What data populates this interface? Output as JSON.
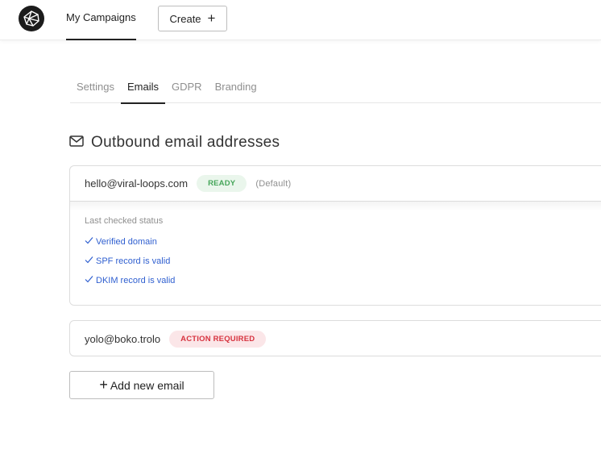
{
  "topbar": {
    "logo_icon": "viral-loops-logo-icon",
    "nav_item": "My Campaigns",
    "create_label": "Create",
    "create_icon": "plus-icon"
  },
  "tabs": [
    {
      "label": "Settings",
      "active": false
    },
    {
      "label": "Emails",
      "active": true
    },
    {
      "label": "GDPR",
      "active": false
    },
    {
      "label": "Branding",
      "active": false
    }
  ],
  "section": {
    "icon": "envelope-icon",
    "title": "Outbound email addresses"
  },
  "emails": [
    {
      "address": "hello@viral-loops.com",
      "status": "READY",
      "status_color": "#46a65a",
      "note": "(Default)",
      "expanded": true,
      "last_checked_label": "Last checked status",
      "checks": [
        {
          "icon": "checkmark-icon",
          "label": "Verified domain"
        },
        {
          "icon": "checkmark-icon",
          "label": "SPF record is valid"
        },
        {
          "icon": "checkmark-icon",
          "label": "DKIM record is valid"
        }
      ]
    },
    {
      "address": "yolo@boko.trolo",
      "status": "ACTION REQUIRED",
      "status_color": "#d7333f",
      "expanded": false
    }
  ],
  "add_button": {
    "icon": "plus-icon",
    "label": "Add new email"
  }
}
